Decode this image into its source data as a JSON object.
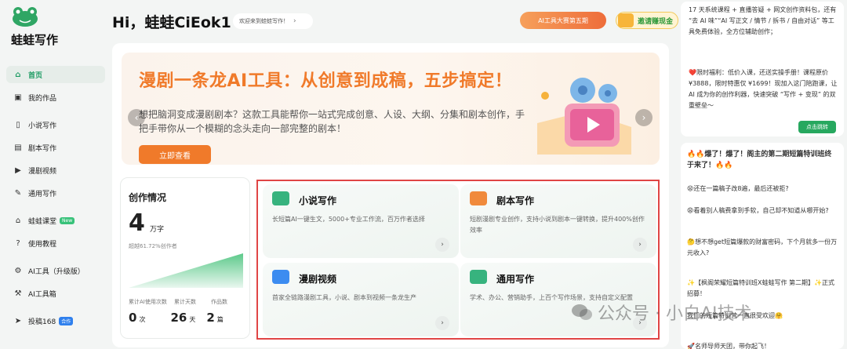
{
  "brand": {
    "name": "蛙蛙写作"
  },
  "sidebar": {
    "items": [
      {
        "label": "首页",
        "icon": "home-icon",
        "active": true
      },
      {
        "label": "我的作品",
        "icon": "folder-icon"
      },
      {
        "label": "小说写作",
        "icon": "book-icon"
      },
      {
        "label": "剧本写作",
        "icon": "script-icon"
      },
      {
        "label": "漫剧视频",
        "icon": "video-icon"
      },
      {
        "label": "通用写作",
        "icon": "edit-icon"
      },
      {
        "label": "蛙蛙课堂",
        "icon": "graduation-cap-icon",
        "badge": "New"
      },
      {
        "label": "使用教程",
        "icon": "help-icon"
      },
      {
        "label": "AI工具（升级版）",
        "icon": "ai-tool-icon"
      },
      {
        "label": "AI工具箱",
        "icon": "toolbox-icon"
      },
      {
        "label": "投稿168",
        "icon": "send-icon",
        "badge": "合作"
      }
    ]
  },
  "header": {
    "greeting": "Hi，蛙蛙CiEok1",
    "welcome": "欢迎来到蛙蛙写作！",
    "contest": "AI工具大赛第五期",
    "invite": "邀请赚现金"
  },
  "banner": {
    "title": "漫剧一条龙AI工具：从创意到成稿，五步搞定！",
    "desc": "想把脑洞变成漫剧剧本？这款工具能帮你一站式完成创意、人设、大纲、分集和剧本创作，手把手带你从一个模糊的念头走向一部完整的剧本！",
    "button": "立即查看"
  },
  "stats": {
    "title": "创作情况",
    "words": "4",
    "words_unit": "万字",
    "note": "超越61.72%创作者",
    "labels": [
      "累计AI使用次数",
      "累计天数",
      "作品数"
    ],
    "values": [
      {
        "v": "0",
        "u": "次"
      },
      {
        "v": "26",
        "u": "天"
      },
      {
        "v": "2",
        "u": "篇"
      }
    ]
  },
  "tools": [
    {
      "name": "小说写作",
      "desc": "长短篇AI一键生文，5000+专业工作流，百万作者选择",
      "color": "#37b37e"
    },
    {
      "name": "剧本写作",
      "desc": "短剧漫剧专业创作，支持小说到剧本一键转换，提升400%创作效率",
      "color": "#f08a3c"
    },
    {
      "name": "漫剧视频",
      "desc": "首家全链路漫剧工具，小说、剧本到视频一条龙生产",
      "color": "#3c8cf0"
    },
    {
      "name": "通用写作",
      "desc": "学术、办公、营销助手，上百个写作场景，支持自定义配置",
      "color": "#37b37e"
    }
  ],
  "right_panel": {
    "card1_lines": [
      "17 天系统课程 + 直播答疑 + 网文创作资料包，还有 “去 AI 味”“AI 写正文 / 情节 / 拆书 / 自由对话” 等工具免费体验，全方位辅助创作；",
      "❤️限时福利：低价入课，还送实操手册！课程原价 ¥3888，限时特惠仅 ¥1699！现加入这门陪跑课，让 AI 成为你的创作利器，快速突破 “写作 + 变现” 的双重壁垒～"
    ],
    "card1_button": "点击跳转",
    "card2_lines": [
      "🔥🔥爆了！爆了！阁主的第二期短篇特训班终于来了！🔥🔥",
      "😫还在一篇稿子改8遍，最后还被拒?",
      "😩看着别人稿费拿到手软，自己却不知道从哪开始?",
      "🤔想不想get短篇爆款的财富密码，下个月就多一份万元收入?",
      "✨【枫阁荣耀短篇特训班X蛙蛙写作 第二期】✨正式招募！",
      "我们的短篇特训营一直很受欢迎🤗",
      "🚀名师导师天团，带你起飞！"
    ]
  },
  "watermark": "公众号 · 小白AI技术"
}
